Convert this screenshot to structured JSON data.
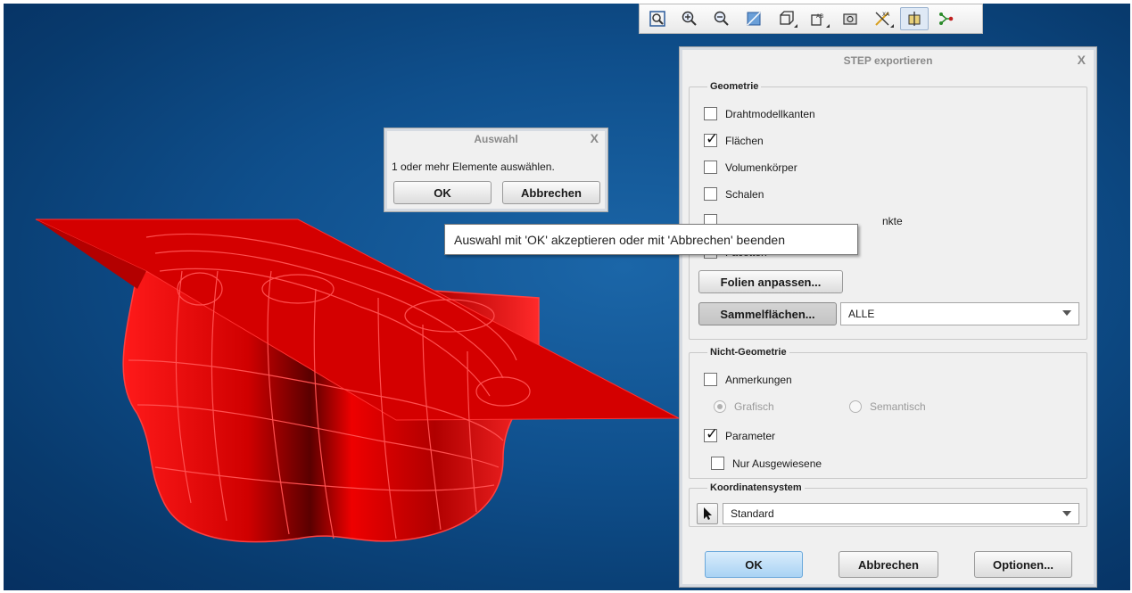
{
  "toolbar": {
    "buttons": [
      {
        "icon": "zoom-fit-icon"
      },
      {
        "icon": "zoom-in-icon"
      },
      {
        "icon": "zoom-out-icon"
      },
      {
        "icon": "display-style-icon"
      },
      {
        "icon": "saved-views-icon"
      },
      {
        "icon": "annotation-display-icon"
      },
      {
        "icon": "spin-center-icon"
      },
      {
        "icon": "datum-display-icon"
      },
      {
        "icon": "datum-planes-icon"
      },
      {
        "icon": "datum-points-icon"
      }
    ]
  },
  "auswahl_dialog": {
    "title": "Auswahl",
    "close": "X",
    "message": "1 oder mehr Elemente auswählen.",
    "ok_label": "OK",
    "cancel_label": "Abbrechen"
  },
  "tooltip": {
    "text": "Auswahl mit 'OK' akzeptieren oder mit 'Abbrechen' beenden"
  },
  "step_dialog": {
    "title": "STEP exportieren",
    "close": "X",
    "geometrie": {
      "legend": "Geometrie",
      "options": [
        {
          "label": "Drahtmodellkanten",
          "checked": false
        },
        {
          "label": "Flächen",
          "checked": true
        },
        {
          "label": "Volumenkörper",
          "checked": false
        },
        {
          "label": "Schalen",
          "checked": false
        },
        {
          "label": "nkte",
          "checked": false
        },
        {
          "label": "Facetten",
          "checked": false
        }
      ],
      "folien_button": "Folien anpassen...",
      "sammel_button": "Sammelflächen...",
      "sammel_value": "ALLE"
    },
    "nicht_geometrie": {
      "legend": "Nicht-Geometrie",
      "anmerkungen": "Anmerkungen",
      "grafisch": "Grafisch",
      "semantisch": "Semantisch",
      "parameter": "Parameter",
      "nur_ausgewiesene": "Nur Ausgewiesene"
    },
    "koordinatensystem": {
      "legend": "Koordinatensystem",
      "value": "Standard"
    },
    "ok_label": "OK",
    "cancel_label": "Abbrechen",
    "options_label": "Optionen..."
  },
  "colors": {
    "model_red": "#ff0000",
    "viewport_blue": "#0f4f8c"
  }
}
